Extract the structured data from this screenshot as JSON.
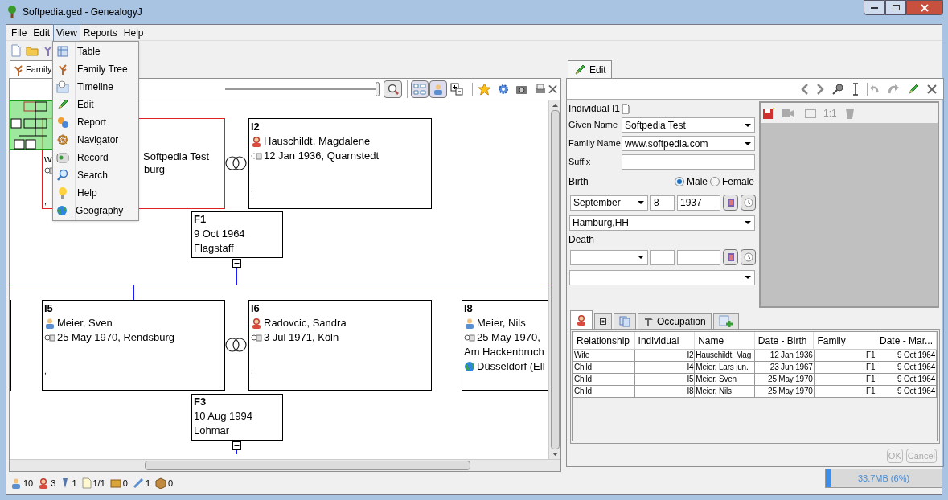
{
  "window": {
    "title": "Softpedia.ged - GenealogyJ"
  },
  "menu_bar": [
    {
      "label": "File",
      "selected": false
    },
    {
      "label": "Edit",
      "selected": false
    },
    {
      "label": "View",
      "selected": true
    },
    {
      "label": "Reports",
      "selected": false
    },
    {
      "label": "Help",
      "selected": false
    }
  ],
  "view_menu": [
    {
      "label": "Table"
    },
    {
      "label": "Family Tree"
    },
    {
      "label": "Timeline"
    },
    {
      "label": "Edit"
    },
    {
      "label": "Report"
    },
    {
      "label": "Navigator"
    },
    {
      "label": "Record"
    },
    {
      "label": "Search"
    },
    {
      "label": "Help"
    },
    {
      "label": "Geography"
    }
  ],
  "tree_view": {
    "tab": "Family",
    "zoom": {
      "level": 1.0
    },
    "covered_node": {
      "fragments": [
        "w",
        "Softpedia Test",
        "burg",
        ","
      ],
      "selected": true
    },
    "individuals": [
      {
        "id": "I2",
        "female": true,
        "name": "Hauschildt, Magdalene",
        "birth": "12 Jan 1936, Quarnstedt",
        "death": ",",
        "selected": false
      },
      {
        "id": "I5",
        "female": false,
        "name": "Meier, Sven",
        "birth": "25 May 1970, Rendsburg",
        "death": ",",
        "selected": false
      },
      {
        "id": "I6",
        "female": true,
        "name": "Radovcic, Sandra",
        "birth": "3 Jul 1971, Köln",
        "death": ",",
        "selected": false
      },
      {
        "id": "I8",
        "female": false,
        "name": "Meier, Nils",
        "birth": "25 May 1970,",
        "address": "Am Hackenbruch",
        "place": "Düsseldorf (Ell",
        "selected": false
      }
    ],
    "families": [
      {
        "id": "F1",
        "date": "9 Oct 1964",
        "place": "Flagstaff",
        "expanded": true
      },
      {
        "id": "F3",
        "date": "10 Aug 1994",
        "place": "Lohmar",
        "expanded": true
      }
    ]
  },
  "status_counts": [
    "10",
    "3",
    "1",
    "1/1",
    "0",
    "1",
    "0"
  ],
  "edit_panel": {
    "tab": "Edit",
    "record": "Individual I1",
    "given_name": {
      "label": "Given Name",
      "value": "Softpedia Test"
    },
    "family_name": {
      "label": "Family Name",
      "value": "www.softpedia.com"
    },
    "suffix": {
      "label": "Suffix"
    },
    "birth": {
      "label": "Birth",
      "month": "September",
      "day": "8",
      "year": "1937",
      "place": "Hamburg,HH"
    },
    "sex": [
      {
        "label": "Male",
        "selected": true
      },
      {
        "label": "Female",
        "selected": false
      }
    ],
    "death": {
      "label": "Death"
    },
    "image_toolbar": {
      "scale": "1:1"
    },
    "tabs": [
      {
        "kind": "person",
        "selected": true
      },
      {
        "kind": "small",
        "selected": false
      },
      {
        "kind": "copy",
        "selected": false
      },
      {
        "kind": "occupation",
        "label": "Occupation",
        "selected": false
      },
      {
        "kind": "add",
        "selected": false
      }
    ],
    "table": {
      "columns": [
        "Relationship",
        "Individual",
        "Name",
        "Date - Birth",
        "Family",
        "Date - Mar..."
      ],
      "rows": [
        [
          "Wife",
          "I2",
          "Hauschildt, Mag",
          "12 Jan 1936",
          "F1",
          "9 Oct 1964"
        ],
        [
          "Child",
          "I4",
          "Meier, Lars jun.",
          "23 Jun 1967",
          "F1",
          "9 Oct 1964"
        ],
        [
          "Child",
          "I5",
          "Meier, Sven",
          "25 May 1970",
          "F1",
          "9 Oct 1964"
        ],
        [
          "Child",
          "I8",
          "Meier, Nils",
          "25 May 1970",
          "F1",
          "9 Oct 1964"
        ]
      ]
    },
    "buttons": [
      {
        "label": "OK",
        "disabled": true
      },
      {
        "label": "Cancel",
        "disabled": true
      }
    ]
  },
  "memory": {
    "text": "33.7MB (6%)",
    "level": 0.04
  }
}
